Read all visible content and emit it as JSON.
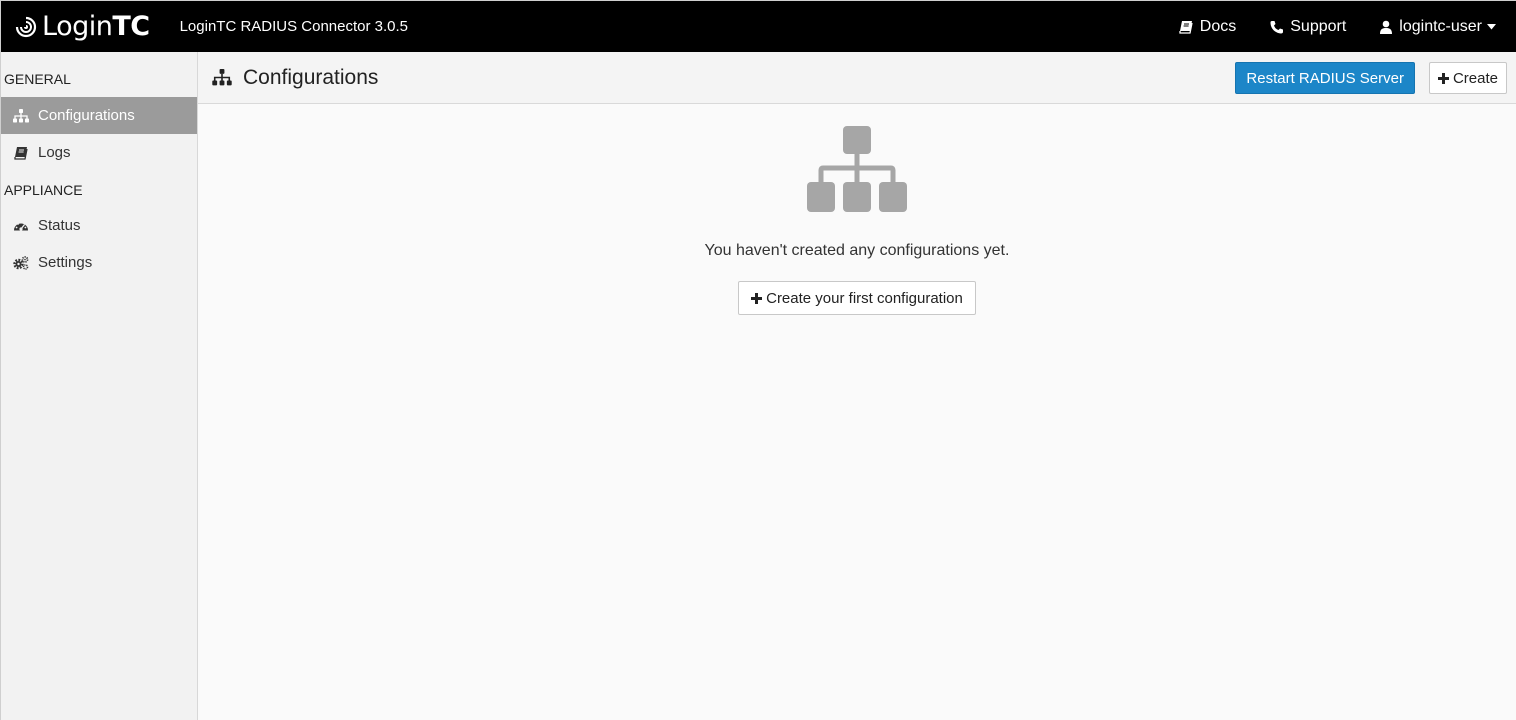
{
  "topbar": {
    "brand_light": "Login",
    "brand_bold": "TC",
    "product": "LoginTC RADIUS Connector 3.0.5",
    "nav": {
      "docs": "Docs",
      "support": "Support",
      "user": "logintc-user"
    }
  },
  "sidebar": {
    "sections": [
      {
        "title": "GENERAL",
        "items": [
          {
            "label": "Configurations",
            "icon": "sitemap-icon",
            "active": true
          },
          {
            "label": "Logs",
            "icon": "book-icon",
            "active": false
          }
        ]
      },
      {
        "title": "APPLIANCE",
        "items": [
          {
            "label": "Status",
            "icon": "dashboard-icon",
            "active": false
          },
          {
            "label": "Settings",
            "icon": "cogs-icon",
            "active": false
          }
        ]
      }
    ]
  },
  "main": {
    "title": "Configurations",
    "restart_button": "Restart RADIUS Server",
    "create_button": "Create",
    "empty_message": "You haven't created any configurations yet.",
    "empty_button": "Create your first configuration"
  },
  "colors": {
    "topbar_bg": "#000000",
    "primary": "#1c86c8",
    "sidebar_active": "#9b9b9b",
    "empty_icon": "#a6a6a6"
  }
}
